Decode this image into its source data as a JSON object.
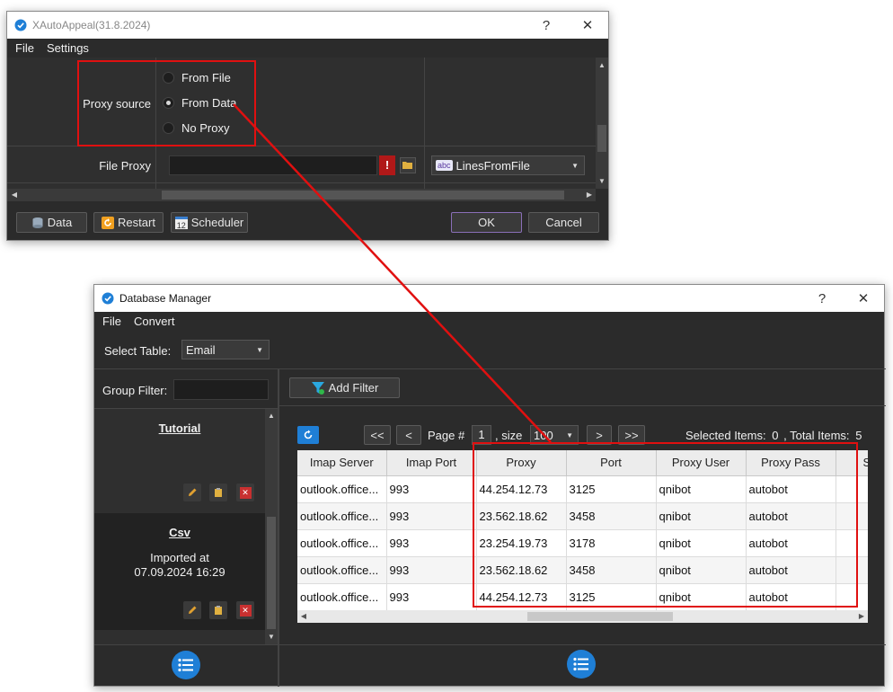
{
  "win1": {
    "title": "XAutoAppeal(31.8.2024)",
    "help": "?",
    "close": "✕",
    "menu": [
      "File",
      "Settings"
    ],
    "proxy_source_label": "Proxy source",
    "radios": [
      {
        "label": "From File",
        "checked": false
      },
      {
        "label": "From Data",
        "checked": true
      },
      {
        "label": "No Proxy",
        "checked": false
      }
    ],
    "file_proxy_label": "File Proxy",
    "file_proxy_value": "",
    "warn_glyph": "!",
    "lines_dropdown": "LinesFromFile",
    "abc_badge": "abc",
    "footer": {
      "data": "Data",
      "restart": "Restart",
      "scheduler": "Scheduler",
      "scheduler_num": "12",
      "ok": "OK",
      "cancel": "Cancel"
    }
  },
  "win2": {
    "title": "Database Manager",
    "help": "?",
    "close": "✕",
    "menu": [
      "File",
      "Convert"
    ],
    "select_table_label": "Select Table:",
    "select_table_value": "Email",
    "group_filter_label": "Group Filter:",
    "add_filter": "Add Filter",
    "groups": [
      {
        "name": "Tutorial",
        "note": ""
      },
      {
        "name": "Csv",
        "note": "Imported at",
        "note2": "07.09.2024 16:29"
      }
    ],
    "pager": {
      "first": "<<",
      "prev": "<",
      "page_label": "Page #",
      "page": "1",
      "size_label": ", size",
      "size": "100",
      "next": ">",
      "last": ">>",
      "selected_label": "Selected Items:",
      "selected": "0",
      "total_label": ", Total Items:",
      "total": "5"
    },
    "columns": [
      "Imap Server",
      "Imap Port",
      "Proxy",
      "Port",
      "Proxy User",
      "Proxy Pass",
      "S"
    ],
    "rows": [
      [
        "outlook.office...",
        "993",
        "44.254.12.73",
        "3125",
        "qnibot",
        "autobot",
        ""
      ],
      [
        "outlook.office...",
        "993",
        "23.562.18.62",
        "3458",
        "qnibot",
        "autobot",
        ""
      ],
      [
        "outlook.office...",
        "993",
        "23.254.19.73",
        "3178",
        "qnibot",
        "autobot",
        ""
      ],
      [
        "outlook.office...",
        "993",
        "23.562.18.62",
        "3458",
        "qnibot",
        "autobot",
        ""
      ],
      [
        "outlook.office...",
        "993",
        "44.254.12.73",
        "3125",
        "qnibot",
        "autobot",
        ""
      ]
    ]
  },
  "colors": {
    "accent": "#1f7fd6",
    "annotation": "#e01010",
    "bg": "#2b2b2b"
  }
}
